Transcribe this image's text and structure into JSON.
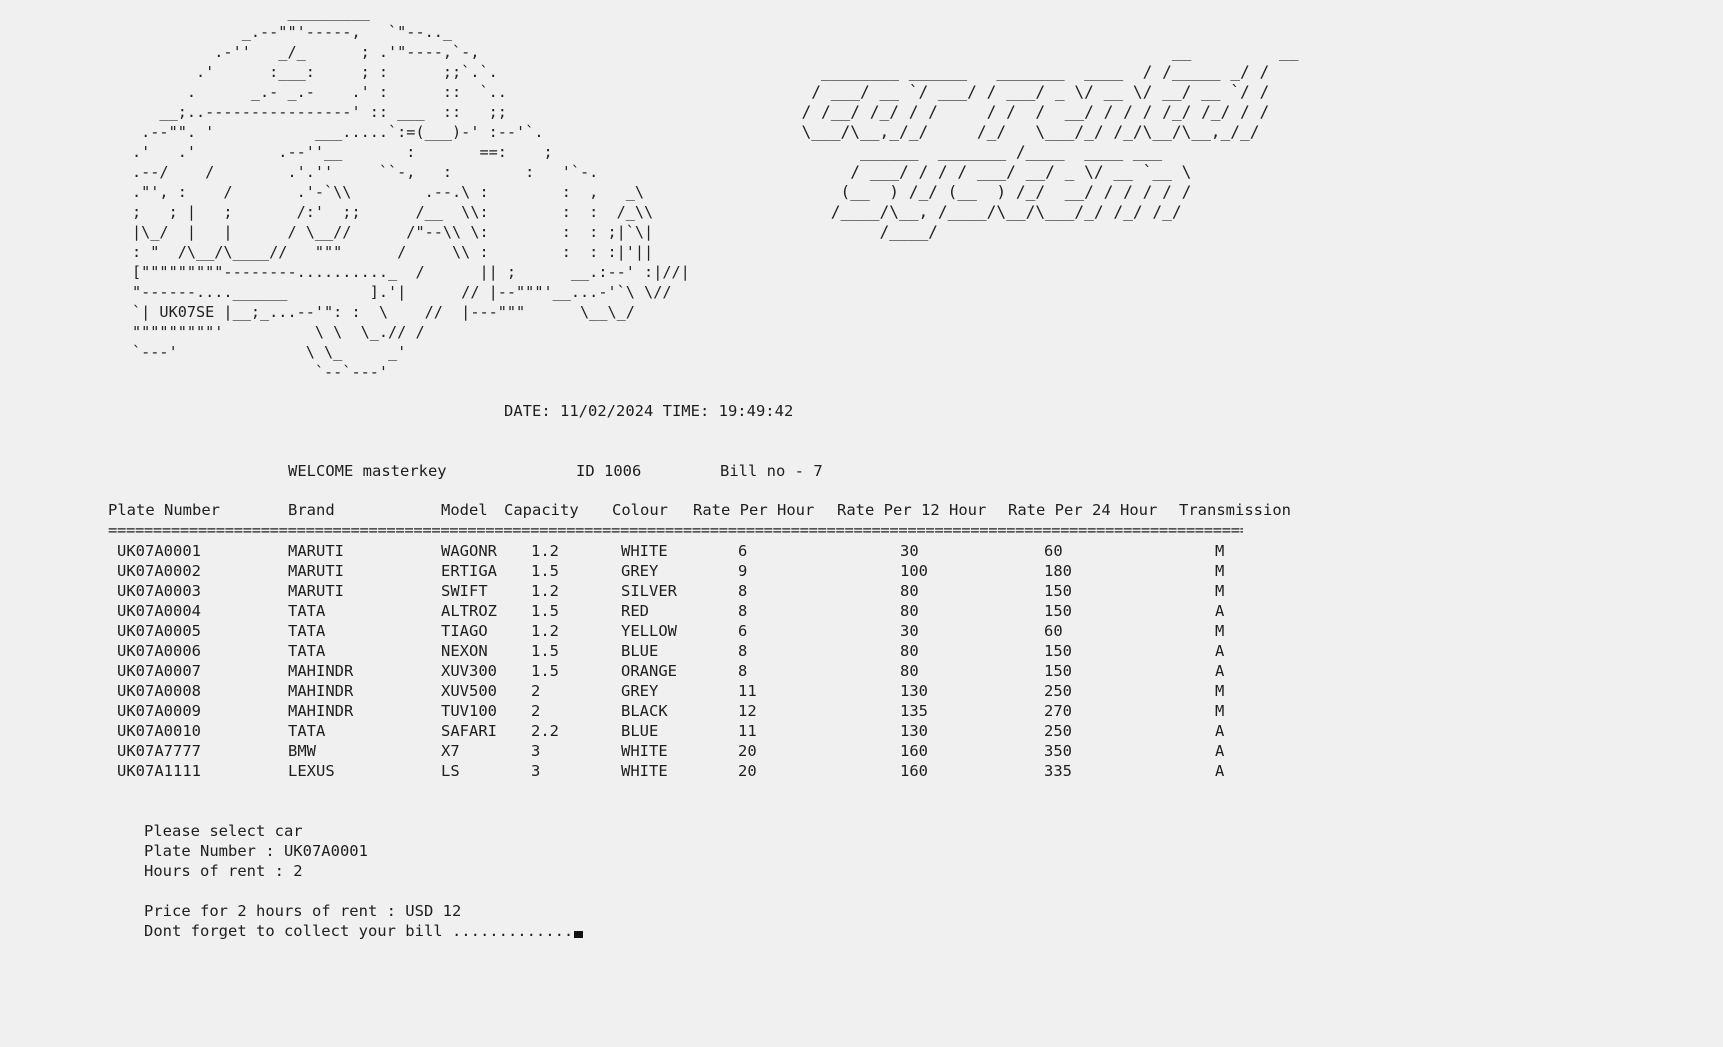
{
  "banner": {
    "car_ascii": "                 _________\n            _.--\"\"'-----,   `\"--.._\n         .-''   _/_      ; .'\"----,`-,\n       .'      :___:     ; :      ;;`.`.\n      .      _.- _.-    .' :      ::  `..\n   __;..----------------' :: ___  ::   ;;\n .--\"\". '           ___.....`:=(___)-' :--'`.\n.'   .'         .--''__       :       ==:    ;\n.--/    /        .'.''     ``-,   :        :   '`-.\n.\"', :    /       .'-`\\\\        .--.\\ :        :  ,   _\\\n;   ; |   ;       /:'  ;;      /__  \\\\:        :  :  /_\\\\\n|\\_/  |   |      / \\__//      /\"--\\\\ \\:        :  : ;|`\\|\n: \"  /\\__/\\____//   \"\"\"      /     \\\\ :        :  : :|'||\n[\"\"\"\"\"\"\"\"\"--------.........._  /      || ;      __.:--' :|//|\n\"------....______         ].'|      // |--\"\"\"'__...-'`\\ \\//\n`| UK07SE |__;_...--'\": :  \\    //  |---\"\"\"      \\__\\_/\n\"\"\"\"\"\"\"\"\"'          \\ \\  \\_.// /\n`---'              \\ \\_     _'\n                    `--`---'",
    "logo_ascii": "                                        __         __\n    ________ ______   _______  ____  / /_____ _/ /\n   / ___/ __ `/ ___/ / ___/ _ \\/ __ \\/ __/ __ `/ /\n  / /__/ /_/ / /     / /  /  __/ / / / /_/ /_/ / /\n  \\___/\\__,_/_/     /_/   \\___/_/ /_/\\__/\\__,_/_/\n        ______  _______ /____  ____ ___\n       / ___/ / / / ___/ __/ _ \\/ __ `__ \\\n      (__  ) /_/ (__  ) /_/  __/ / / / / /\n     /____/\\__, /____/\\__/\\___/_/ /_/ /_/\n          /____/"
  },
  "datetime": "DATE: 11/02/2024 TIME: 19:49:42",
  "session": {
    "welcome": "WELCOME masterkey",
    "id": "ID 1006",
    "bill": "Bill no - 7"
  },
  "table": {
    "headers": [
      "Plate Number",
      "Brand",
      "Model",
      "Capacity",
      "Colour",
      "Rate Per Hour",
      "Rate Per 12 Hour",
      "Rate Per 24 Hour",
      "Transmission"
    ],
    "separator": "==================================================================================================================================",
    "rows": [
      [
        "UK07A0001",
        "MARUTI",
        "WAGONR",
        "1.2",
        "WHITE",
        "6",
        "30",
        "60",
        "M"
      ],
      [
        "UK07A0002",
        "MARUTI",
        "ERTIGA",
        "1.5",
        "GREY",
        "9",
        "100",
        "180",
        "M"
      ],
      [
        "UK07A0003",
        "MARUTI",
        "SWIFT",
        "1.2",
        "SILVER",
        "8",
        "80",
        "150",
        "M"
      ],
      [
        "UK07A0004",
        "TATA",
        "ALTROZ",
        "1.5",
        "RED",
        "8",
        "80",
        "150",
        "A"
      ],
      [
        "UK07A0005",
        "TATA",
        "TIAGO",
        "1.2",
        "YELLOW",
        "6",
        "30",
        "60",
        "M"
      ],
      [
        "UK07A0006",
        "TATA",
        "NEXON",
        "1.5",
        "BLUE",
        "8",
        "80",
        "150",
        "A"
      ],
      [
        "UK07A0007",
        "MAHINDR",
        "XUV300",
        "1.5",
        "ORANGE",
        "8",
        "80",
        "150",
        "A"
      ],
      [
        "UK07A0008",
        "MAHINDR",
        "XUV500",
        "2",
        "GREY",
        "11",
        "130",
        "250",
        "M"
      ],
      [
        "UK07A0009",
        "MAHINDR",
        "TUV100",
        "2",
        "BLACK",
        "12",
        "135",
        "270",
        "M"
      ],
      [
        "UK07A0010",
        "TATA",
        "SAFARI",
        "2.2",
        "BLUE",
        "11",
        "130",
        "250",
        "A"
      ],
      [
        "UK07A7777",
        "BMW",
        "X7",
        "3",
        "WHITE",
        "20",
        "160",
        "350",
        "A"
      ],
      [
        "UK07A1111",
        "LEXUS",
        "LS",
        "3",
        "WHITE",
        "20",
        "160",
        "335",
        "A"
      ]
    ]
  },
  "prompt": {
    "select": "Please select car",
    "plate": "Plate Number : UK07A0001",
    "hours": "Hours of rent : 2",
    "price": "Price for 2 hours of rent : USD 12",
    "bill_note": "Dont forget to collect your bill ............."
  }
}
